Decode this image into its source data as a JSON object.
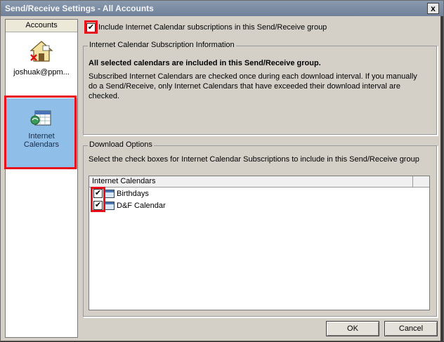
{
  "window": {
    "title": "Send/Receive Settings - All Accounts",
    "close_glyph": "x"
  },
  "sidebar": {
    "header": "Accounts",
    "items": [
      {
        "label": "joshuak@ppm...",
        "icon": "account-icon"
      },
      {
        "label_line1": "Internet",
        "label_line2": "Calendars",
        "icon": "internet-calendars-icon",
        "selected": true
      }
    ]
  },
  "main": {
    "include_checkbox": {
      "label": "Include Internet Calendar subscriptions in this Send/Receive group",
      "checked": true
    },
    "info_group": {
      "legend": "Internet Calendar Subscription Information",
      "bold_text": "All selected calendars are included in this Send/Receive group.",
      "text": "Subscribed Internet Calendars are checked once during each download interval. If you manually do a Send/Receive, only Internet Calendars that have exceeded their download interval are checked."
    },
    "download_group": {
      "legend": "Download Options",
      "text": "Select the check boxes for Internet Calendar Subscriptions to include in this Send/Receive group",
      "list_header": "Internet Calendars",
      "calendars": [
        {
          "name": "Birthdays",
          "checked": true
        },
        {
          "name": "D&F Calendar",
          "checked": true
        }
      ]
    }
  },
  "buttons": {
    "ok": "OK",
    "cancel": "Cancel"
  },
  "colors": {
    "highlight": "#e8111b",
    "selected_item": "#8fbfe8"
  }
}
